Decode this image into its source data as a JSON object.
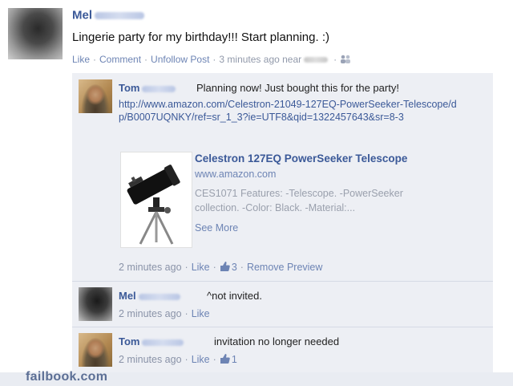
{
  "post": {
    "author_first": "Mel",
    "text": "Lingerie party for my birthday!!! Start planning. :)",
    "actions": [
      "Like",
      "Comment",
      "Unfollow Post"
    ],
    "time": "3 minutes ago near"
  },
  "comments": [
    {
      "author_first": "Tom",
      "text": "Planning now! Just bought this for the party!",
      "url": "http://www.amazon.com/Celestron-21049-127EQ-PowerSeeker-Telescope/dp/B0007UQNKY/ref=sr_1_3?ie=UTF8&qid=1322457643&sr=8-3",
      "preview": {
        "title": "Celestron 127EQ PowerSeeker Telescope",
        "domain": "www.amazon.com",
        "description": "CES1071 Features: -Telescope. -PowerSeeker collection. -Color: Black. -Material:...",
        "see_more": "See More"
      },
      "time": "2 minutes ago",
      "like": "Like",
      "likes_count": "3",
      "remove_preview": "Remove Preview"
    },
    {
      "author_first": "Mel",
      "text": "^not invited.",
      "time": "2 minutes ago",
      "like": "Like"
    },
    {
      "author_first": "Tom",
      "text": "invitation no longer needed",
      "time": "2 minutes ago",
      "like": "Like",
      "likes_count": "1"
    }
  ],
  "watermark": "failbook.com",
  "colors": {
    "link": "#3b5998",
    "comment_bg": "#edeff4"
  }
}
